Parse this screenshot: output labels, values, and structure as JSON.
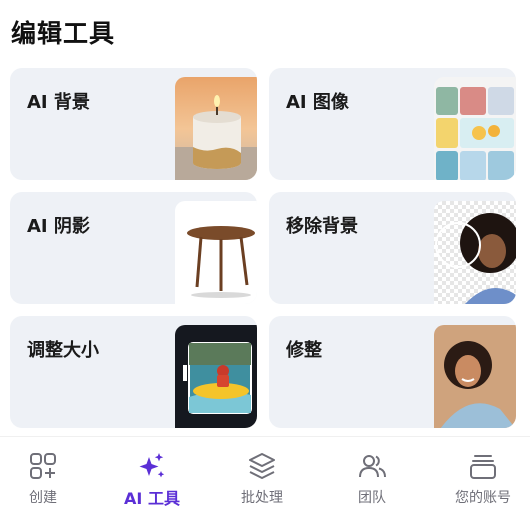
{
  "section": {
    "title": "编辑工具"
  },
  "tools": [
    {
      "id": "ai-background",
      "label": "AI 背景",
      "thumb": "candle-photo"
    },
    {
      "id": "ai-image",
      "label": "AI 图像",
      "thumb": "product-collage"
    },
    {
      "id": "ai-shadow",
      "label": "AI 阴影",
      "thumb": "stool-photo"
    },
    {
      "id": "remove-background",
      "label": "移除背景",
      "thumb": "portrait-cutout"
    },
    {
      "id": "resize",
      "label": "调整大小",
      "thumb": "rafting-photo"
    },
    {
      "id": "retouch",
      "label": "修整",
      "thumb": "portrait-smile"
    }
  ],
  "tabbar": {
    "items": [
      {
        "label": "创建",
        "icon": "grid-plus-icon",
        "active": false
      },
      {
        "label": "AI 工具",
        "icon": "sparkle-icon",
        "active": true
      },
      {
        "label": "批处理",
        "icon": "layers-icon",
        "active": false
      },
      {
        "label": "团队",
        "icon": "people-icon",
        "active": false
      },
      {
        "label": "您的账号",
        "icon": "account-stack-icon",
        "active": false
      }
    ]
  },
  "colors": {
    "accent": "#5b2fd6",
    "card_bg": "#eef1f6",
    "inactive": "#6f6f78"
  }
}
